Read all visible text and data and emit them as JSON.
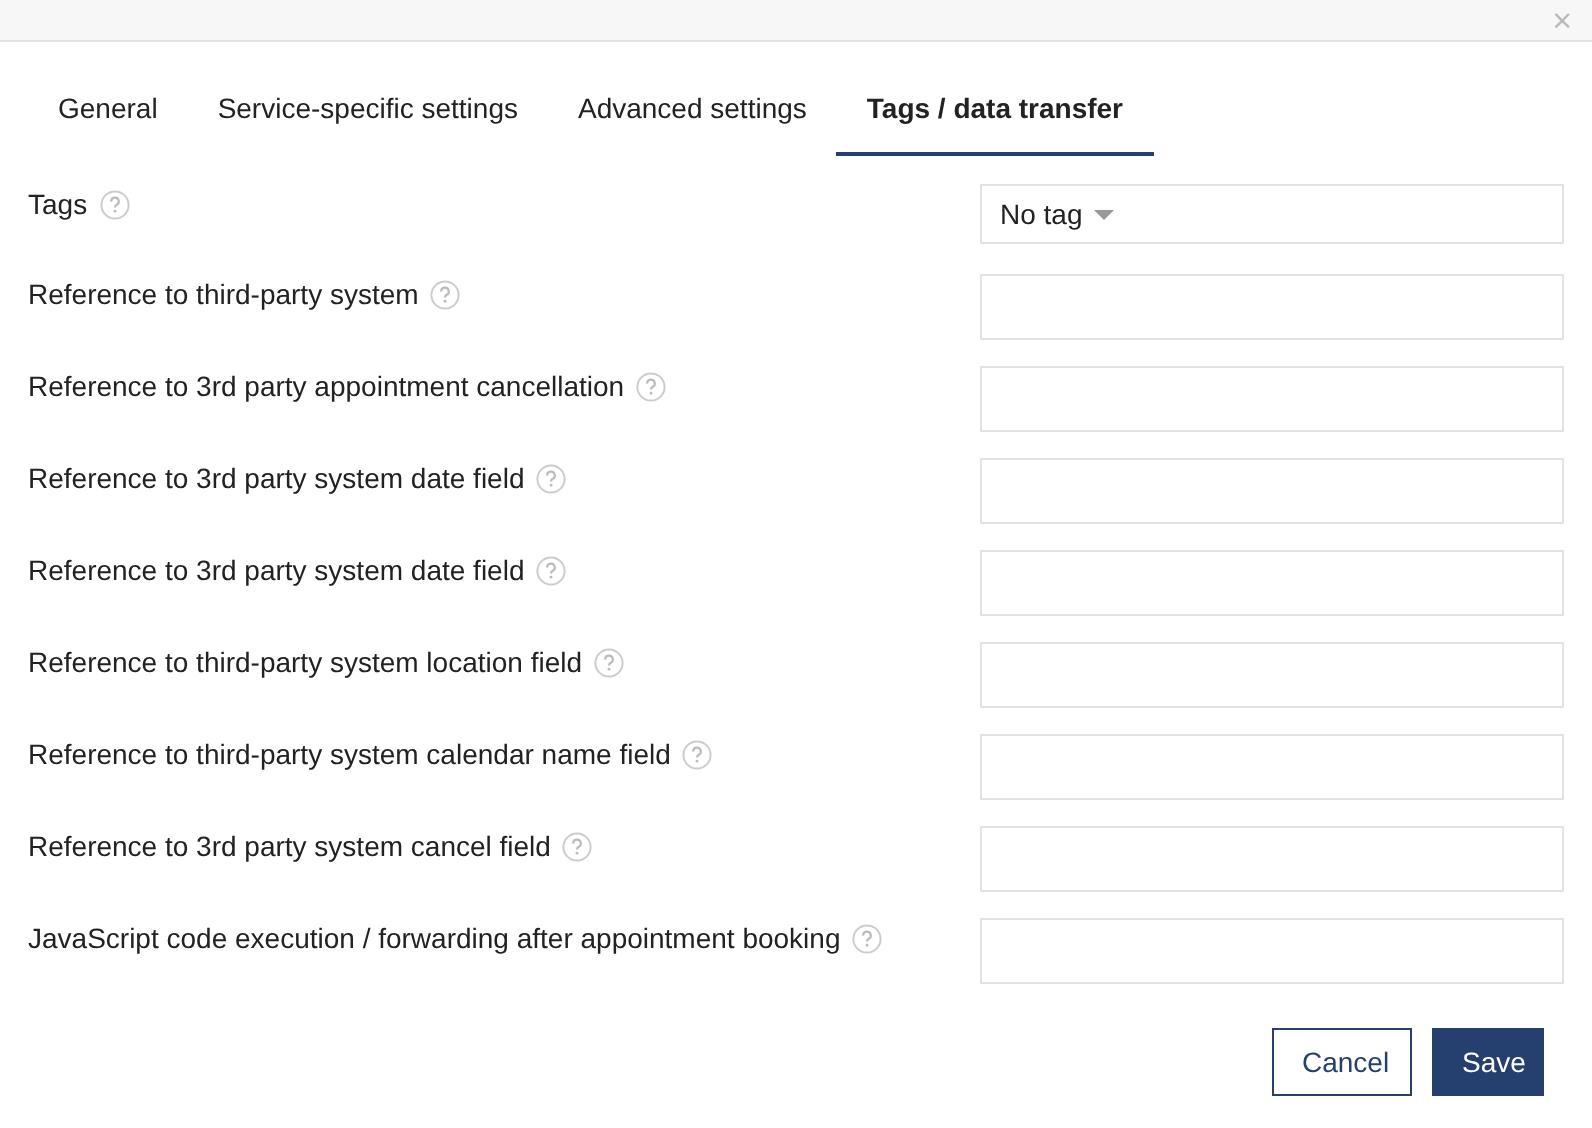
{
  "close": "×",
  "tabs": [
    {
      "label": "General",
      "selected": false
    },
    {
      "label": "Service-specific settings",
      "selected": false
    },
    {
      "label": "Advanced settings",
      "selected": false
    },
    {
      "label": "Tags / data transfer",
      "selected": true
    }
  ],
  "fields": [
    {
      "kind": "select",
      "label": "Tags",
      "value": "No tag"
    },
    {
      "kind": "text",
      "label": "Reference to third-party system"
    },
    {
      "kind": "text",
      "label": "Reference to 3rd party appointment cancellation"
    },
    {
      "kind": "text",
      "label": "Reference to 3rd party system date field"
    },
    {
      "kind": "text",
      "label": "Reference to 3rd party system date field"
    },
    {
      "kind": "text",
      "label": "Reference to third-party system location field"
    },
    {
      "kind": "text",
      "label": "Reference to third-party system calendar name field"
    },
    {
      "kind": "text",
      "label": "Reference to 3rd party system cancel field"
    },
    {
      "kind": "text",
      "label": "JavaScript code execution / forwarding after appointment booking"
    }
  ],
  "buttons": [
    {
      "kind": "secondary",
      "label": "Cancel"
    },
    {
      "kind": "primary",
      "label": "Save"
    }
  ]
}
